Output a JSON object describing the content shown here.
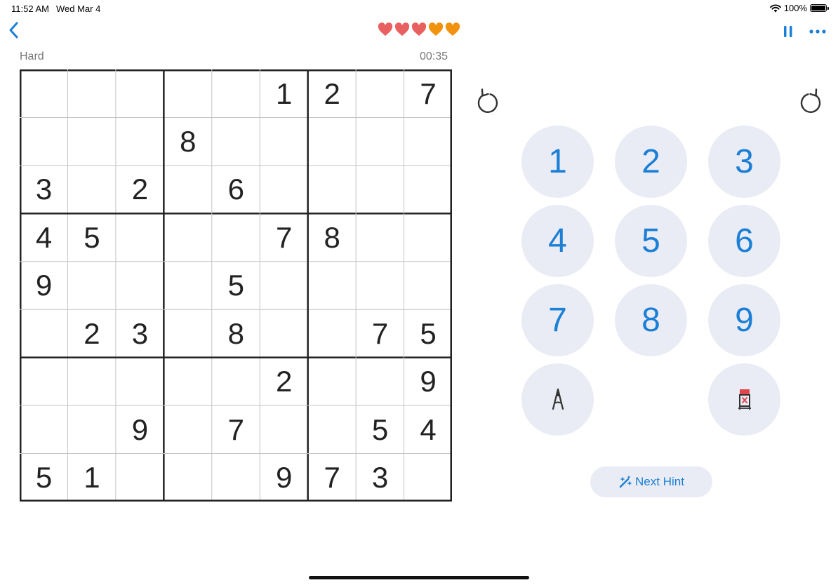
{
  "status_bar": {
    "time": "11:52 AM",
    "date": "Wed Mar 4",
    "battery": "100%"
  },
  "header": {
    "hearts": [
      "#e8605f",
      "#e8605f",
      "#e8605f",
      "#f2930f",
      "#f2930f"
    ]
  },
  "game": {
    "difficulty": "Hard",
    "timer": "00:35"
  },
  "board": {
    "rows": [
      [
        "",
        "",
        "",
        "",
        "",
        "1",
        "2",
        "",
        "7"
      ],
      [
        "",
        "",
        "",
        "8",
        "",
        "",
        "",
        "",
        ""
      ],
      [
        "3",
        "",
        "2",
        "",
        "6",
        "",
        "",
        "",
        ""
      ],
      [
        "4",
        "5",
        "",
        "",
        "",
        "7",
        "8",
        "",
        ""
      ],
      [
        "9",
        "",
        "",
        "",
        "5",
        "",
        "",
        "",
        ""
      ],
      [
        "",
        "2",
        "3",
        "",
        "8",
        "",
        "",
        "7",
        "5"
      ],
      [
        "",
        "",
        "",
        "",
        "",
        "2",
        "",
        "",
        "9"
      ],
      [
        "",
        "",
        "9",
        "",
        "7",
        "",
        "",
        "5",
        "4"
      ],
      [
        "5",
        "1",
        "",
        "",
        "",
        "9",
        "7",
        "3",
        ""
      ]
    ]
  },
  "keypad": {
    "numbers": [
      "1",
      "2",
      "3",
      "4",
      "5",
      "6",
      "7",
      "8",
      "9"
    ]
  },
  "hint": {
    "label": "Next Hint"
  },
  "colors": {
    "accent": "#1b7fd6",
    "key_bg": "#e9ecf4"
  }
}
